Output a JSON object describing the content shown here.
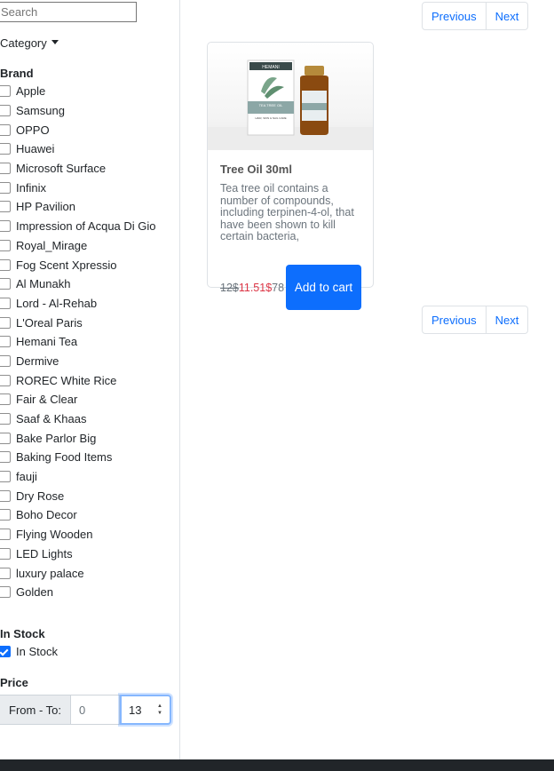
{
  "sidebar": {
    "search_placeholder": "Search",
    "category_label": "Category",
    "brand_title": "Brand",
    "brands": [
      {
        "label": "Apple",
        "checked": false
      },
      {
        "label": "Samsung",
        "checked": false
      },
      {
        "label": "OPPO",
        "checked": false
      },
      {
        "label": "Huawei",
        "checked": false
      },
      {
        "label": "Microsoft Surface",
        "checked": false
      },
      {
        "label": "Infinix",
        "checked": false
      },
      {
        "label": "HP Pavilion",
        "checked": false
      },
      {
        "label": "Impression of Acqua Di Gio",
        "checked": false
      },
      {
        "label": "Royal_Mirage",
        "checked": false
      },
      {
        "label": "Fog Scent Xpressio",
        "checked": false
      },
      {
        "label": "Al Munakh",
        "checked": false
      },
      {
        "label": "Lord - Al-Rehab",
        "checked": false
      },
      {
        "label": "L'Oreal Paris",
        "checked": false
      },
      {
        "label": "Hemani Tea",
        "checked": false
      },
      {
        "label": "Dermive",
        "checked": false
      },
      {
        "label": "ROREC White Rice",
        "checked": false
      },
      {
        "label": "Fair & Clear",
        "checked": false
      },
      {
        "label": "Saaf & Khaas",
        "checked": false
      },
      {
        "label": "Bake Parlor Big",
        "checked": false
      },
      {
        "label": "Baking Food Items",
        "checked": false
      },
      {
        "label": "fauji",
        "checked": false
      },
      {
        "label": "Dry Rose",
        "checked": false
      },
      {
        "label": "Boho Decor",
        "checked": false
      },
      {
        "label": "Flying Wooden",
        "checked": false
      },
      {
        "label": "LED Lights",
        "checked": false
      },
      {
        "label": "luxury palace",
        "checked": false
      },
      {
        "label": "Golden",
        "checked": false
      }
    ],
    "stock_title": "In Stock",
    "stock_option": {
      "label": "In Stock",
      "checked": true
    },
    "price_title": "Price",
    "price_prefix": "From - To:",
    "price_from": "0",
    "price_to": "13"
  },
  "pagination": {
    "previous_label": "Previous",
    "next_label": "Next"
  },
  "product": {
    "title": "Tree Oil 30ml",
    "description": "Tea tree oil contains a number of compounds, including terpinen-4-ol, that have been shown to kill certain bacteria,",
    "old_price": "12$",
    "new_price": "11.51$",
    "extra_price_text": "78",
    "add_to_cart_label": "Add to cart",
    "image_labels": {
      "box_brand": "HEMANI",
      "box_name": "TEA TREE OIL",
      "box_sub": "HAIR, SKIN & NAIL CARE"
    }
  },
  "colors": {
    "primary": "#0d6efd",
    "sale": "#dc3545",
    "footer": "#212529"
  }
}
